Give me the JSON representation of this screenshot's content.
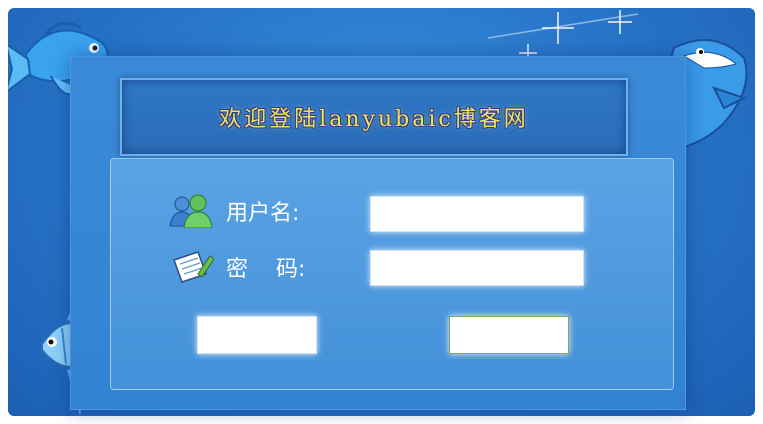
{
  "title": "欢迎登陆lanyubaic博客网",
  "form": {
    "username_label": "用户名:",
    "password_label": "密    码:",
    "username_value": "",
    "password_value": "",
    "login_label": "",
    "reset_label": ""
  },
  "icons": {
    "user": "users-icon",
    "password": "edit-note-icon"
  },
  "colors": {
    "background": "#2a78cc",
    "title_text": "#f6e05a"
  }
}
